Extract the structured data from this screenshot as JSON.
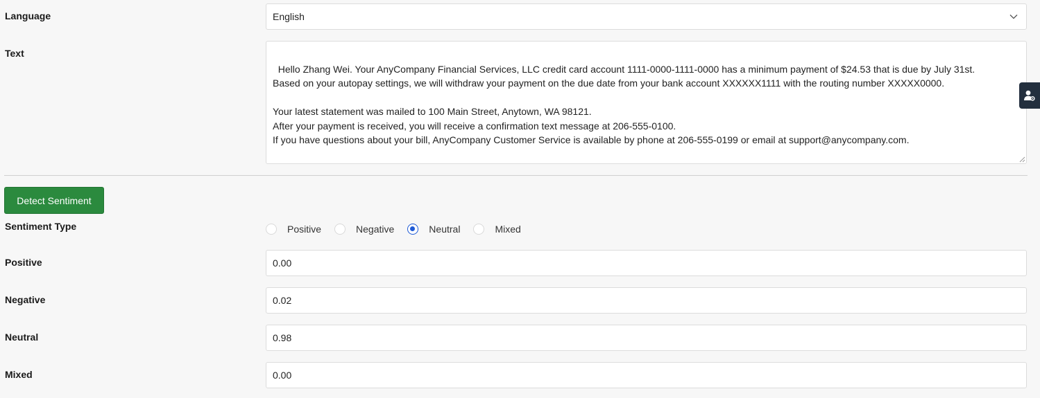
{
  "language": {
    "label": "Language",
    "selected": "English"
  },
  "text": {
    "label": "Text",
    "value": "Hello Zhang Wei. Your AnyCompany Financial Services, LLC credit card account 1111-0000-1111-0000 has a minimum payment of $24.53 that is due by July 31st.\nBased on your autopay settings, we will withdraw your payment on the due date from your bank account XXXXXX1111 with the routing number XXXXX0000.\n\nYour latest statement was mailed to 100 Main Street, Anytown, WA 98121.\nAfter your payment is received, you will receive a confirmation text message at 206-555-0100.\nIf you have questions about your bill, AnyCompany Customer Service is available by phone at 206-555-0199 or email at support@anycompany.com."
  },
  "detect_button": "Detect Sentiment",
  "sentiment_type": {
    "label": "Sentiment Type",
    "options": [
      "Positive",
      "Negative",
      "Neutral",
      "Mixed"
    ],
    "selected": "Neutral"
  },
  "scores": {
    "positive": {
      "label": "Positive",
      "value": "0.00"
    },
    "negative": {
      "label": "Negative",
      "value": "0.02"
    },
    "neutral": {
      "label": "Neutral",
      "value": "0.98"
    },
    "mixed": {
      "label": "Mixed",
      "value": "0.00"
    }
  },
  "icons": {
    "select_chevron": "chevron-down-icon",
    "side_tab": "user-gear-icon"
  },
  "colors": {
    "button": "#2b8a3e",
    "radio_selected": "#1f5bd6",
    "side_tab": "#232f3e"
  }
}
